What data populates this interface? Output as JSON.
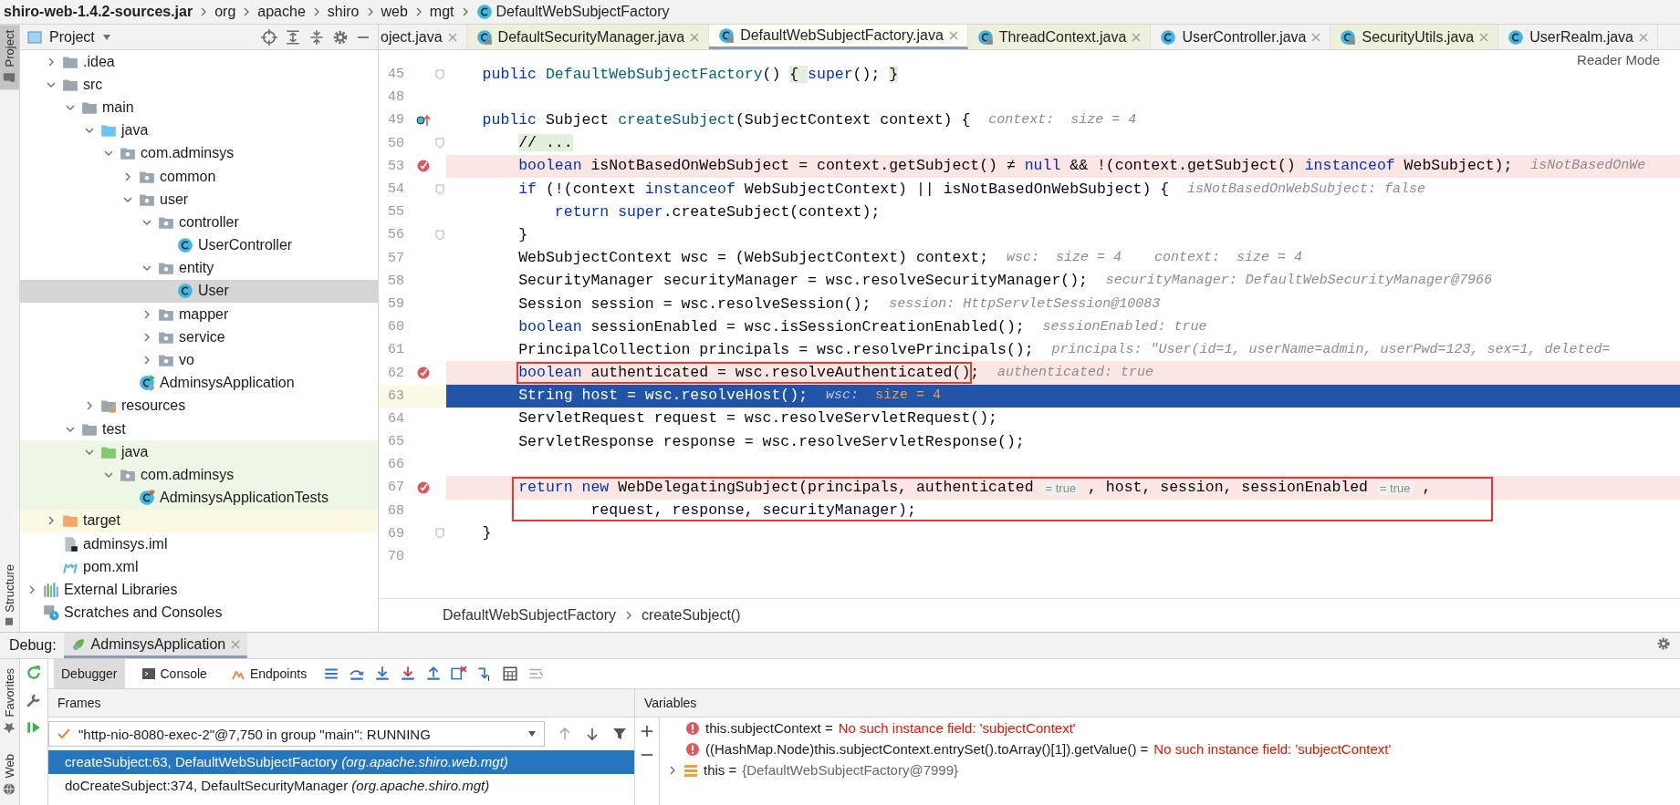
{
  "breadcrumb": [
    {
      "label": "shiro-web-1.4.2-sources.jar",
      "kind": "jar"
    },
    {
      "label": "org",
      "kind": "package"
    },
    {
      "label": "apache",
      "kind": "package"
    },
    {
      "label": "shiro",
      "kind": "package"
    },
    {
      "label": "web",
      "kind": "package"
    },
    {
      "label": "mgt",
      "kind": "package"
    },
    {
      "label": "DefaultWebSubjectFactory",
      "kind": "class"
    }
  ],
  "left_stripe": [
    {
      "label": "Project",
      "kind": "project",
      "selected": true
    },
    {
      "label": "Structure",
      "kind": "structure",
      "selected": false
    }
  ],
  "project_panel": {
    "title": "Project",
    "tree": [
      {
        "children": [
          {
            "label": ".idea",
            "kind": "folder",
            "expanded": false,
            "selected": false
          },
          {
            "label": "src",
            "kind": "folder",
            "expanded": true,
            "selected": false,
            "children": [
              {
                "label": "main",
                "kind": "folder",
                "expanded": true,
                "selected": false,
                "children": [
                  {
                    "label": "java",
                    "kind": "source-folder",
                    "expanded": true,
                    "selected": false,
                    "children": [
                      {
                        "label": "com.adminsys",
                        "kind": "package",
                        "expanded": true,
                        "selected": false,
                        "children": [
                          {
                            "label": "common",
                            "kind": "package",
                            "expanded": false,
                            "selected": false
                          },
                          {
                            "label": "user",
                            "kind": "package",
                            "expanded": true,
                            "selected": false,
                            "children": [
                              {
                                "label": "controller",
                                "kind": "package",
                                "expanded": true,
                                "selected": false,
                                "children": [
                                  {
                                    "label": "UserController",
                                    "kind": "class",
                                    "selected": false
                                  }
                                ]
                              },
                              {
                                "label": "entity",
                                "kind": "package",
                                "expanded": true,
                                "selected": false,
                                "children": [
                                  {
                                    "label": "User",
                                    "kind": "class",
                                    "selected": true
                                  }
                                ]
                              },
                              {
                                "label": "mapper",
                                "kind": "package",
                                "expanded": false,
                                "selected": false
                              },
                              {
                                "label": "service",
                                "kind": "package",
                                "expanded": false,
                                "selected": false
                              },
                              {
                                "label": "vo",
                                "kind": "package",
                                "expanded": false,
                                "selected": false
                              }
                            ]
                          },
                          {
                            "label": "AdminsysApplication",
                            "kind": "app-class",
                            "selected": false
                          }
                        ]
                      }
                    ]
                  },
                  {
                    "label": "resources",
                    "kind": "resources-folder",
                    "expanded": false,
                    "selected": false
                  }
                ]
              },
              {
                "label": "test",
                "kind": "folder",
                "expanded": true,
                "selected": false,
                "children": [
                  {
                    "label": "java",
                    "kind": "test-folder",
                    "expanded": true,
                    "selected": false,
                    "children": [
                      {
                        "label": "com.adminsys",
                        "kind": "test-package",
                        "expanded": true,
                        "selected": false,
                        "children": [
                          {
                            "label": "AdminsysApplicationTests",
                            "kind": "test-class",
                            "selected": false
                          }
                        ]
                      }
                    ]
                  }
                ]
              }
            ]
          },
          {
            "label": "target",
            "kind": "excluded-folder",
            "expanded": false,
            "selected": false
          },
          {
            "label": "adminsys.iml",
            "kind": "iml",
            "selected": false
          },
          {
            "label": "pom.xml",
            "kind": "maven",
            "selected": false
          }
        ]
      },
      {
        "label": "External Libraries",
        "kind": "libraries",
        "expanded": false,
        "selected": false
      },
      {
        "label": "Scratches and Consoles",
        "kind": "scratches",
        "selected": false
      }
    ]
  },
  "editor": {
    "tabs": [
      {
        "label": "oject.java",
        "kind": "plain",
        "selected": false,
        "library": false
      },
      {
        "label": "DefaultSecurityManager.java",
        "kind": "class-locked",
        "selected": false,
        "library": true
      },
      {
        "label": "DefaultWebSubjectFactory.java",
        "kind": "class-locked",
        "selected": true,
        "library": true
      },
      {
        "label": "ThreadContext.java",
        "kind": "class-locked",
        "selected": false,
        "library": true
      },
      {
        "label": "UserController.java",
        "kind": "class",
        "selected": false,
        "library": false
      },
      {
        "label": "SecurityUtils.java",
        "kind": "class-locked",
        "selected": false,
        "library": true
      },
      {
        "label": "UserRealm.java",
        "kind": "class",
        "selected": false,
        "library": false
      }
    ],
    "reader_mode": "Reader Mode",
    "lines": [
      {
        "number": "45",
        "kind": "fold",
        "boxed": false,
        "tokens": [
          {
            "kind": "kw",
            "text": "    public "
          },
          {
            "kind": "method",
            "text": "DefaultWebSubjectFactory"
          },
          {
            "kind": "code",
            "text": "() "
          },
          {
            "kind": "fold",
            "text": "{ "
          },
          {
            "kind": "kw",
            "text": "super"
          },
          {
            "kind": "code",
            "text": "(); "
          },
          {
            "kind": "fold",
            "text": "}"
          }
        ]
      },
      {
        "number": "48",
        "kind": "plain",
        "boxed": false
      },
      {
        "number": "49",
        "kind": "override",
        "boxed": false,
        "tokens": [
          {
            "kind": "kw",
            "text": "    public "
          },
          {
            "kind": "code",
            "text": "Subject "
          },
          {
            "kind": "method",
            "text": "createSubject"
          },
          {
            "kind": "code",
            "text": "(SubjectContext context) {  "
          },
          {
            "kind": "hint",
            "text": "context:  size = 4"
          }
        ]
      },
      {
        "number": "50",
        "kind": "fold",
        "boxed": false,
        "tokens": [
          {
            "kind": "fold",
            "text": "        // ..."
          }
        ]
      },
      {
        "number": "53",
        "kind": "breakpoint",
        "boxed": false,
        "tokens": [
          {
            "kind": "kw",
            "text": "        boolean "
          },
          {
            "kind": "code",
            "text": "isNotBasedOnWebSubject = context.getSubject() ≠ "
          },
          {
            "kind": "kw",
            "text": "null"
          },
          {
            "kind": "code",
            "text": " && !(context.getSubject() "
          },
          {
            "kind": "kw",
            "text": "instanceof"
          },
          {
            "kind": "code",
            "text": " WebSubject);  "
          },
          {
            "kind": "hint",
            "text": "isNotBasedOnWe"
          }
        ]
      },
      {
        "number": "54",
        "kind": "fold",
        "boxed": false,
        "tokens": [
          {
            "kind": "kw",
            "text": "        if"
          },
          {
            "kind": "code",
            "text": " (!(context "
          },
          {
            "kind": "kw",
            "text": "instanceof"
          },
          {
            "kind": "code",
            "text": " WebSubjectContext) || isNotBasedOnWebSubject) {  "
          },
          {
            "kind": "hint",
            "text": "isNotBasedOnWebSubject: false"
          }
        ]
      },
      {
        "number": "55",
        "kind": "plain",
        "boxed": false,
        "tokens": [
          {
            "kind": "kw",
            "text": "            return super"
          },
          {
            "kind": "code",
            "text": ".createSubject(context);"
          }
        ]
      },
      {
        "number": "56",
        "kind": "fold",
        "boxed": false,
        "tokens": [
          {
            "kind": "code",
            "text": "        }"
          }
        ]
      },
      {
        "number": "57",
        "kind": "plain",
        "boxed": false,
        "tokens": [
          {
            "kind": "code",
            "text": "        WebSubjectContext wsc = (WebSubjectContext) context;  "
          },
          {
            "kind": "hint",
            "text": "wsc:  size = 4    context:  size = 4"
          }
        ]
      },
      {
        "number": "58",
        "kind": "plain",
        "boxed": false,
        "tokens": [
          {
            "kind": "code",
            "text": "        SecurityManager securityManager = wsc.resolveSecurityManager();  "
          },
          {
            "kind": "hint",
            "text": "securityManager: DefaultWebSecurityManager@7966"
          }
        ]
      },
      {
        "number": "59",
        "kind": "plain",
        "boxed": false,
        "tokens": [
          {
            "kind": "code",
            "text": "        Session session = wsc.resolveSession();  "
          },
          {
            "kind": "hint",
            "text": "session: HttpServletSession@10083"
          }
        ]
      },
      {
        "number": "60",
        "kind": "plain",
        "boxed": false,
        "tokens": [
          {
            "kind": "kw",
            "text": "        boolean "
          },
          {
            "kind": "code",
            "text": "sessionEnabled = wsc.isSessionCreationEnabled();  "
          },
          {
            "kind": "hint",
            "text": "sessionEnabled: true"
          }
        ]
      },
      {
        "number": "61",
        "kind": "plain",
        "boxed": false,
        "tokens": [
          {
            "kind": "code",
            "text": "        PrincipalCollection principals = wsc.resolvePrincipals();  "
          },
          {
            "kind": "hint",
            "text": "principals: \"User(id=1, userName=admin, userPwd=123, sex=1, deleted="
          }
        ]
      },
      {
        "number": "62",
        "kind": "breakpoint",
        "boxed": false,
        "tokens": [
          {
            "kind": "kw",
            "text": "        boolean ",
            "boxed": true
          },
          {
            "kind": "code",
            "text": "authenticated = wsc.resolveAuthenticated()",
            "boxed": true
          },
          {
            "kind": "code",
            "text": ";  ",
            "boxed": false
          },
          {
            "kind": "hint",
            "text": "authenticated: true",
            "boxed": false
          }
        ]
      },
      {
        "number": "63",
        "kind": "current",
        "boxed": false,
        "tokens": [
          {
            "kind": "code",
            "text": "        String host = wsc.resolveHost();  "
          },
          {
            "kind": "hint",
            "text": "wsc:  "
          },
          {
            "kind": "value",
            "text": "size = 4"
          }
        ]
      },
      {
        "number": "64",
        "kind": "plain",
        "boxed": false,
        "tokens": [
          {
            "kind": "code",
            "text": "        ServletRequest request = wsc.resolveServletRequest();"
          }
        ]
      },
      {
        "number": "65",
        "kind": "plain",
        "boxed": false,
        "tokens": [
          {
            "kind": "code",
            "text": "        ServletResponse response = wsc.resolveServletResponse();"
          }
        ]
      },
      {
        "number": "66",
        "kind": "plain",
        "boxed": false
      },
      {
        "number": "67",
        "kind": "breakpoint",
        "boxed": true,
        "tokens": [
          {
            "kind": "kw",
            "text": "        return new"
          },
          {
            "kind": "code",
            "text": " WebDelegatingSubject(principals, authenticated "
          },
          {
            "kind": "param",
            "text": "= true"
          },
          {
            "kind": "code",
            "text": " , host, session, sessionEnabled "
          },
          {
            "kind": "param",
            "text": "= true"
          },
          {
            "kind": "code",
            "text": " ,"
          }
        ]
      },
      {
        "number": "68",
        "kind": "plain",
        "boxed": true,
        "tokens": [
          {
            "kind": "code",
            "text": "                request, response, securityManager);"
          }
        ]
      },
      {
        "number": "69",
        "kind": "fold",
        "boxed": false,
        "tokens": [
          {
            "kind": "code",
            "text": "    }"
          }
        ]
      },
      {
        "number": "70",
        "kind": "plain",
        "boxed": false
      }
    ],
    "breadcrumb": [
      "DefaultWebSubjectFactory",
      "createSubject()"
    ]
  },
  "debug": {
    "label": "Debug:",
    "session": "AdminsysApplication",
    "stripe": [
      {
        "label": "Favorites",
        "kind": "star"
      },
      {
        "label": "Web",
        "kind": "globe"
      }
    ],
    "tabs": [
      {
        "label": "Debugger",
        "selected": true,
        "kind": "debugger"
      },
      {
        "label": "Console",
        "selected": false,
        "kind": "console"
      },
      {
        "label": "Endpoints",
        "selected": false,
        "kind": "endpoints"
      }
    ],
    "frames": {
      "title": "Frames",
      "thread": "\"http-nio-8080-exec-2\"@7,750 in group \"main\": RUNNING",
      "rows": [
        {
          "text": "createSubject:63, DefaultWebSubjectFactory *(org.apache.shiro.web.mgt)*",
          "selected": true
        },
        {
          "text": "doCreateSubject:374, DefaultSecurityManager *(org.apache.shiro.mgt)*",
          "selected": false
        }
      ]
    },
    "variables": {
      "title": "Variables",
      "rows": [
        {
          "kind": "error",
          "name": "this.subjectContext = ",
          "value": "No such instance field: 'subjectContext'"
        },
        {
          "kind": "error",
          "name": "((HashMap.Node)this.subjectContext.entrySet().toArray()[1]).getValue() = ",
          "value": "No such instance field: 'subjectContext'"
        },
        {
          "kind": "object",
          "name": "this = ",
          "value": "{DefaultWebSubjectFactory@7999}",
          "expanded": false
        }
      ]
    }
  }
}
